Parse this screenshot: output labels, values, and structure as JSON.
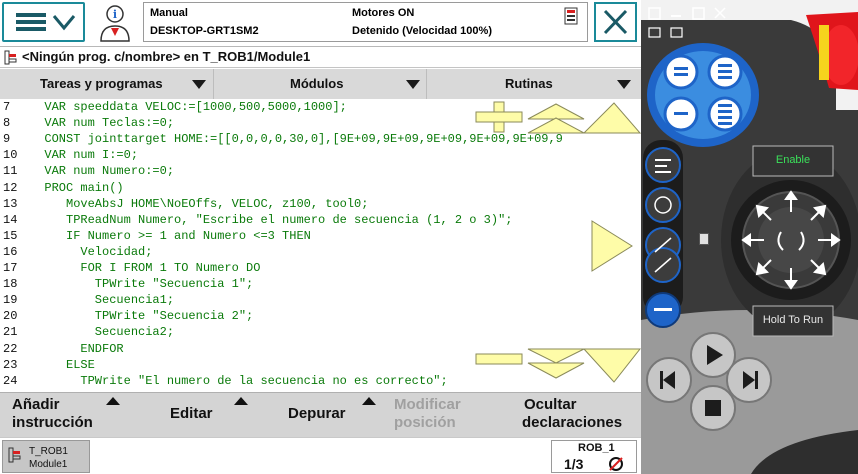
{
  "header": {
    "mode": "Manual",
    "controller": "DESKTOP-GRT1SM2",
    "motors": "Motores ON",
    "state": "Detenido (Velocidad 100%)"
  },
  "breadcrumb": "<Ningún prog. c/nombre> en T_ROB1/Module1",
  "tabs": [
    {
      "label": "Tareas y programas"
    },
    {
      "label": "Módulos"
    },
    {
      "label": "Rutinas"
    }
  ],
  "code_lines": [
    {
      "n": "7",
      "text": "  VAR speeddata VELOC:=[1000,500,5000,1000];"
    },
    {
      "n": "8",
      "text": "  VAR num Teclas:=0;"
    },
    {
      "n": "9",
      "text": "  CONST jointtarget HOME:=[[0,0,0,0,30,0],[9E+09,9E+09,9E+09,9E+09,9E+09,9"
    },
    {
      "n": "10",
      "text": "  VAR num I:=0;"
    },
    {
      "n": "11",
      "text": "  VAR num Numero:=0;"
    },
    {
      "n": "12",
      "text": "  PROC main()"
    },
    {
      "n": "13",
      "text": "     MoveAbsJ HOME\\NoEOffs, VELOC, z100, tool0;"
    },
    {
      "n": "14",
      "text": "     TPReadNum Numero, \"Escribe el numero de secuencia (1, 2 o 3)\";"
    },
    {
      "n": "15",
      "text": "     IF Numero >= 1 and Numero <=3 THEN"
    },
    {
      "n": "16",
      "text": "       Velocidad;"
    },
    {
      "n": "17",
      "text": "       FOR I FROM 1 TO Numero DO"
    },
    {
      "n": "18",
      "text": "         TPWrite \"Secuencia 1\";"
    },
    {
      "n": "19",
      "text": "         Secuencia1;"
    },
    {
      "n": "20",
      "text": "         TPWrite \"Secuencia 2\";"
    },
    {
      "n": "21",
      "text": "         Secuencia2;"
    },
    {
      "n": "22",
      "text": "       ENDFOR"
    },
    {
      "n": "23",
      "text": "     ELSE"
    },
    {
      "n": "24",
      "text": "       TPWrite \"El numero de la secuencia no es correcto\";"
    }
  ],
  "bottom": {
    "add_l1": "Añadir",
    "add_l2": "instrucción",
    "edit": "Editar",
    "debug": "Depurar",
    "modify_l1": "Modificar",
    "modify_l2": "posición",
    "hide_l1": "Ocultar",
    "hide_l2": "declaraciones"
  },
  "taskbar": {
    "task_l1": "T_ROB1",
    "task_l2": "Module1",
    "rob": "ROB_1",
    "frac": "1/3"
  },
  "pendant": {
    "enable": "Enable",
    "hold": "Hold To Run"
  },
  "colors": {
    "accent": "#1a8a99",
    "code_text": "#0a7a0a",
    "overlay_yellow": "#fefca8",
    "pendant_blue": "#1e64c8",
    "pendant_dark": "#3c3c3c",
    "emergency_red": "#e0151b"
  },
  "icons": [
    "hamburger-icon",
    "chevron-down-icon",
    "user-info-icon",
    "status-icon",
    "close-icon",
    "program-icon",
    "task-icon"
  ]
}
